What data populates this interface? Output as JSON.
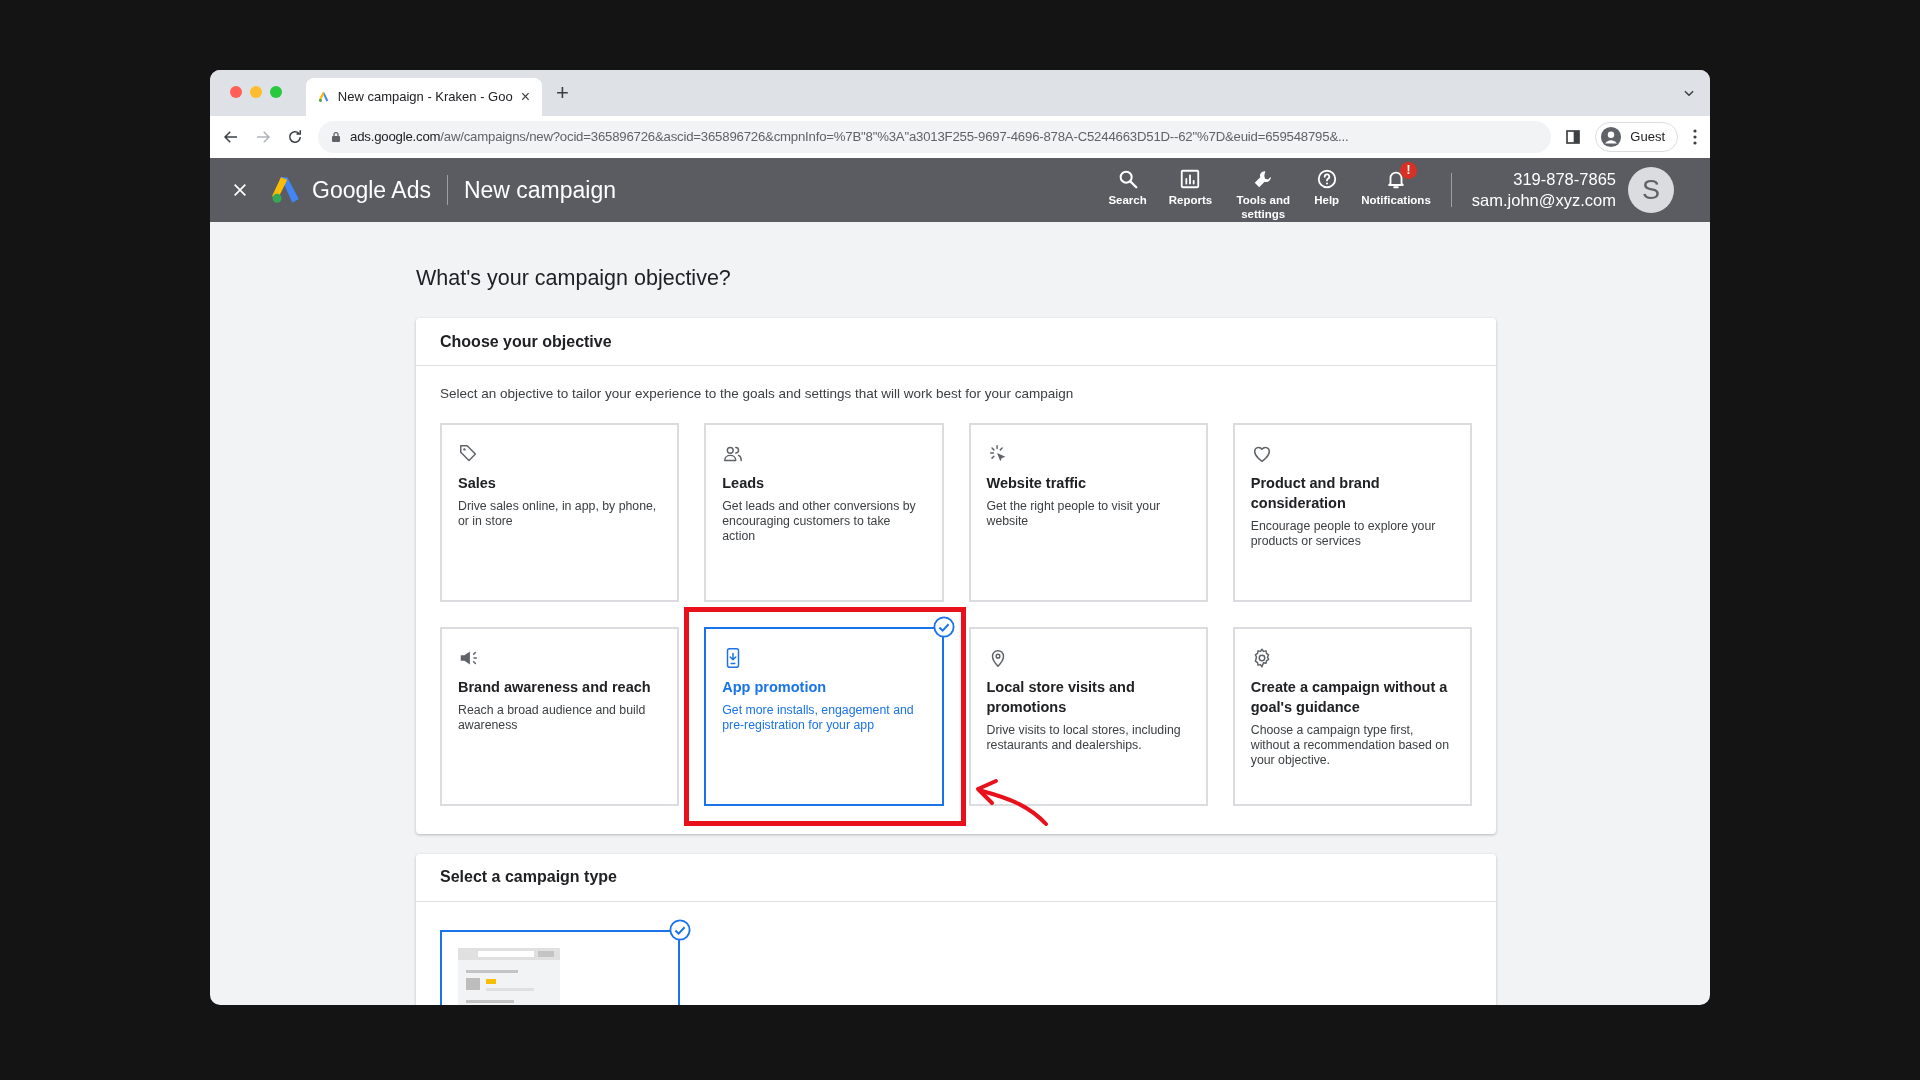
{
  "browser": {
    "tab": {
      "title": "New campaign - Kraken - Goo",
      "close": "×"
    },
    "new_tab": "+",
    "address": {
      "host": "ads.google.com",
      "path": "/aw/campaigns/new?ocid=365896726&ascid=365896726&cmpnInfo=%7B\"8\"%3A\"a3013F255-9697-4696-878A-C5244663D51D--62\"%7D&euid=659548795&..."
    },
    "profile": "Guest"
  },
  "header": {
    "brand": "Google Ads",
    "page_title": "New campaign",
    "nav": [
      {
        "label": "Search",
        "badge": false
      },
      {
        "label": "Reports",
        "badge": false
      },
      {
        "label": "Tools and settings",
        "badge": false
      },
      {
        "label": "Help",
        "badge": false
      },
      {
        "label": "Notifications",
        "badge": true,
        "badge_text": "!"
      }
    ],
    "account": {
      "phone": "319-878-7865",
      "email": "sam.john@xyz.com",
      "avatar": "S"
    }
  },
  "heading": "What's your campaign objective?",
  "objective_card": {
    "title": "Choose your objective",
    "intro": "Select an objective to tailor your experience to the goals and settings that will work best for your campaign",
    "objectives": [
      {
        "title": "Sales",
        "description": "Drive sales online, in app, by phone, or in store",
        "selected": false,
        "annotated": false
      },
      {
        "title": "Leads",
        "description": "Get leads and other conversions by encouraging customers to take action",
        "selected": false,
        "annotated": false
      },
      {
        "title": "Website traffic",
        "description": "Get the right people to visit your website",
        "selected": false,
        "annotated": false
      },
      {
        "title": "Product and brand consideration",
        "description": "Encourage people to explore your products or services",
        "selected": false,
        "annotated": false
      },
      {
        "title": "Brand awareness and reach",
        "description": "Reach a broad audience and build awareness",
        "selected": false,
        "annotated": false
      },
      {
        "title": "App promotion",
        "description": "Get more installs, engagement and pre-registration for your app",
        "selected": true,
        "annotated": true
      },
      {
        "title": "Local store visits and promotions",
        "description": "Drive visits to local stores, including restaurants and dealerships.",
        "selected": false,
        "annotated": false
      },
      {
        "title": "Create a campaign without a goal's guidance",
        "description": "Choose a campaign type first, without a recommendation based on your objective.",
        "selected": false,
        "annotated": false
      }
    ]
  },
  "campaign_type_card": {
    "title": "Select a campaign type",
    "types": [
      {
        "selected": true
      }
    ]
  }
}
